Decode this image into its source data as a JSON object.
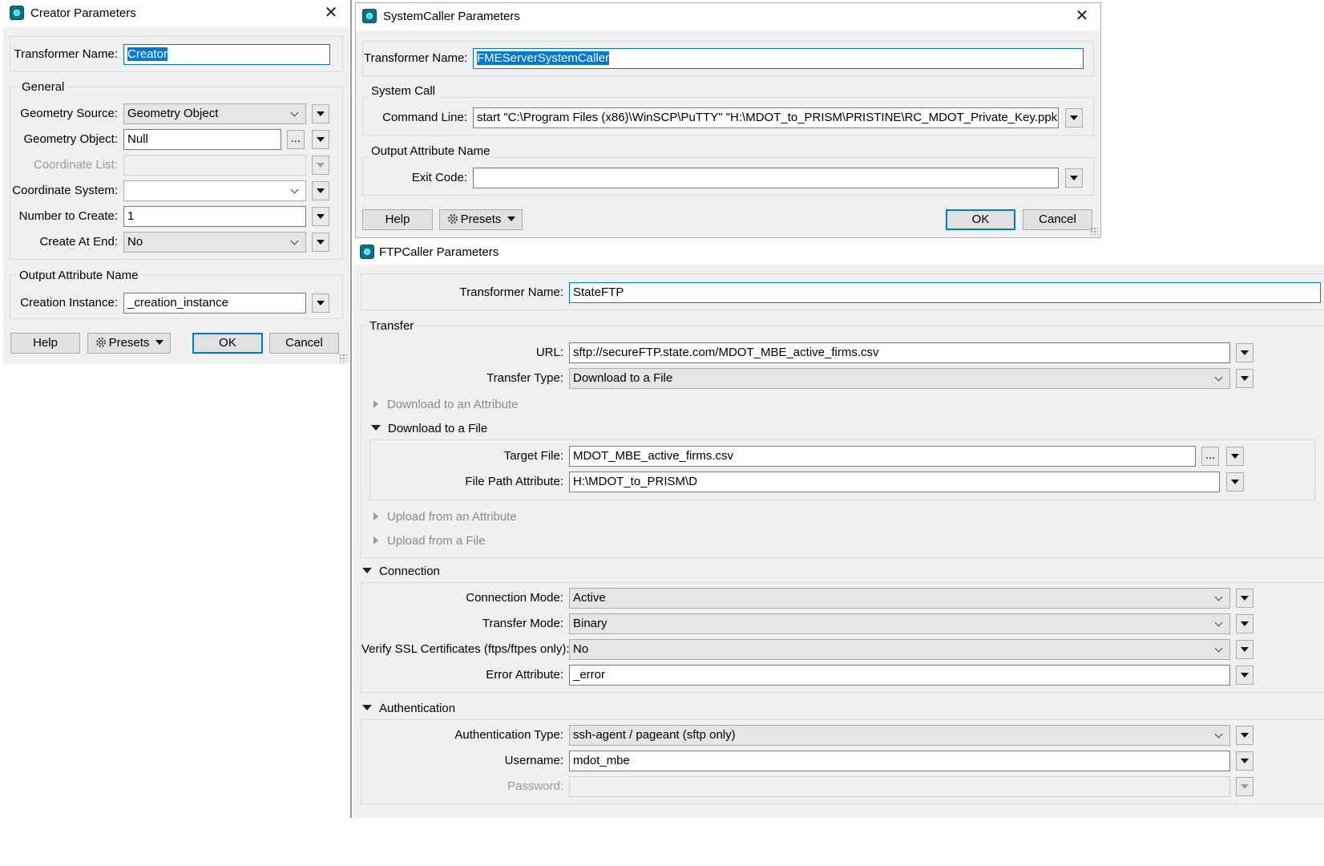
{
  "creator": {
    "title": "Creator Parameters",
    "transformer_name_label": "Transformer Name:",
    "transformer_name_value": "Creator",
    "general_label": "General",
    "geometry_source_label": "Geometry Source:",
    "geometry_source_value": "Geometry Object",
    "geometry_object_label": "Geometry Object:",
    "geometry_object_value": "Null",
    "coordinate_list_label": "Coordinate List:",
    "coordinate_list_value": "",
    "coordinate_system_label": "Coordinate System:",
    "coordinate_system_value": "",
    "number_to_create_label": "Number to Create:",
    "number_to_create_value": "1",
    "create_at_end_label": "Create At End:",
    "create_at_end_value": "No",
    "output_attr_label": "Output Attribute Name",
    "creation_instance_label": "Creation Instance:",
    "creation_instance_value": "_creation_instance",
    "help": "Help",
    "presets": "Presets",
    "ok": "OK",
    "cancel": "Cancel",
    "ellipsis": "..."
  },
  "systemcaller": {
    "title": "SystemCaller Parameters",
    "transformer_name_label": "Transformer Name:",
    "transformer_name_value": "FMEServerSystemCaller",
    "system_call_label": "System Call",
    "command_line_label": "Command Line:",
    "command_line_value": "start  \"C:\\Program Files (x86)\\WinSCP\\PuTTY\" \"H:\\MDOT_to_PRISM\\PRISTINE\\RC_MDOT_Private_Key.ppk\"",
    "output_attr_label": "Output Attribute Name",
    "exit_code_label": "Exit Code:",
    "exit_code_value": "",
    "help": "Help",
    "presets": "Presets",
    "ok": "OK",
    "cancel": "Cancel"
  },
  "ftpcaller": {
    "title": "FTPCaller Parameters",
    "transformer_name_label": "Transformer Name:",
    "transformer_name_value": "StateFTP",
    "transfer_label": "Transfer",
    "url_label": "URL:",
    "url_value": "sftp://secureFTP.state.com/MDOT_MBE_active_firms.csv",
    "transfer_type_label": "Transfer Type:",
    "transfer_type_value": "Download to a File",
    "download_attr_label": "Download to an Attribute",
    "download_file_label": "Download to a File",
    "target_file_label": "Target File:",
    "target_file_value": "MDOT_MBE_active_firms.csv",
    "file_path_attr_label": "File Path Attribute:",
    "file_path_attr_value": "H:\\MDOT_to_PRISM\\D",
    "upload_attr_label": "Upload from an Attribute",
    "upload_file_label": "Upload from a File",
    "connection_label": "Connection",
    "connection_mode_label": "Connection Mode:",
    "connection_mode_value": "Active",
    "transfer_mode_label": "Transfer Mode:",
    "transfer_mode_value": "Binary",
    "verify_ssl_label": "Verify SSL Certificates (ftps/ftpes only):",
    "verify_ssl_value": "No",
    "error_attr_label": "Error Attribute:",
    "error_attr_value": "_error",
    "authentication_label": "Authentication",
    "auth_type_label": "Authentication Type:",
    "auth_type_value": "ssh-agent / pageant (sftp only)",
    "username_label": "Username:",
    "username_value": "mdot_mbe",
    "password_label": "Password:",
    "password_value": "",
    "ellipsis": "..."
  },
  "colors": {
    "accent": "#0078d7",
    "dialog_bg": "#f0f0f0",
    "icon": "#0a6f88"
  }
}
